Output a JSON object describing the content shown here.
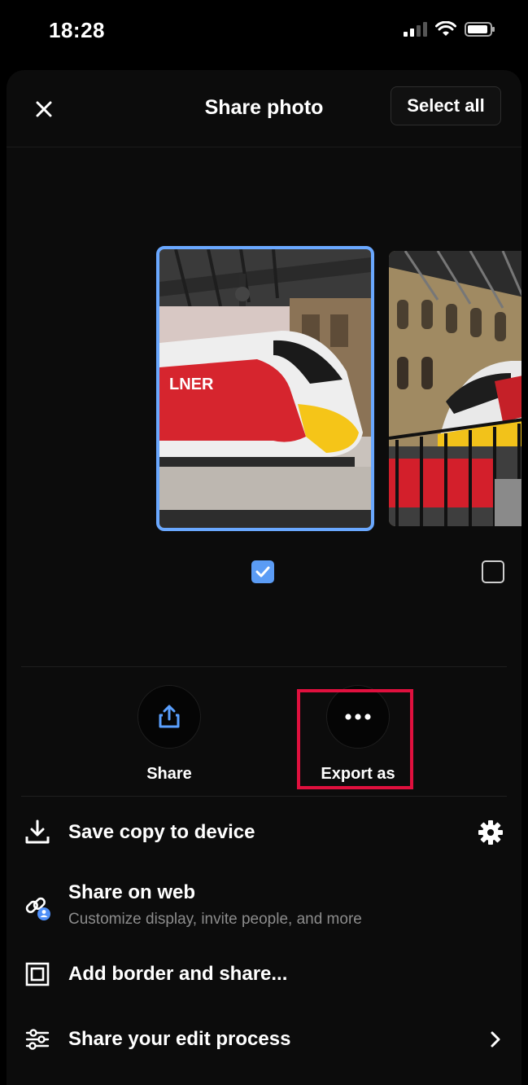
{
  "status_bar": {
    "time": "18:28"
  },
  "header": {
    "title": "Share photo",
    "select_all_label": "Select all"
  },
  "photos": [
    {
      "name": "LNER train at station",
      "selected": true
    },
    {
      "name": "Train under station canopy",
      "selected": false
    }
  ],
  "actions": [
    {
      "label": "Share",
      "icon": "share-upload-icon"
    },
    {
      "label": "Export as",
      "icon": "more-dots-icon"
    }
  ],
  "list": [
    {
      "label": "Save copy to device",
      "icon": "download-icon",
      "trailing": "gear-icon"
    },
    {
      "label": "Share on web",
      "sublabel": "Customize display, invite people, and more",
      "icon": "link-people-icon"
    },
    {
      "label": "Add border and share...",
      "icon": "border-frame-icon"
    },
    {
      "label": "Share your edit process",
      "icon": "sliders-icon",
      "trailing": "chevron-right-icon"
    }
  ],
  "colors": {
    "accent": "#6aa8ff",
    "checkbox": "#5b9cf5",
    "highlight": "#e0103e",
    "share_icon": "#5aa0ff"
  }
}
